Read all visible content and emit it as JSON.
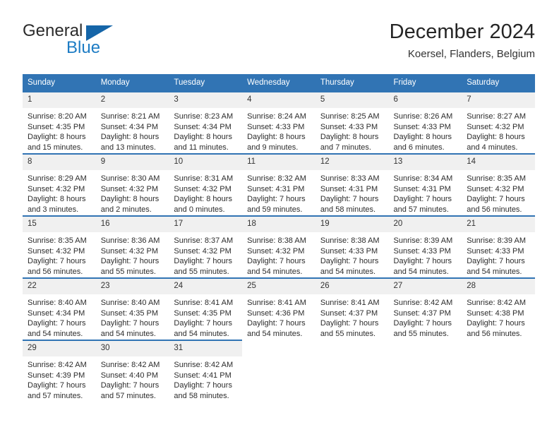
{
  "brand": {
    "name_part1": "General",
    "name_part2": "Blue",
    "triangle_color": "#1565a8",
    "blue_text_color": "#1d7cc4"
  },
  "header": {
    "title": "December 2024",
    "subtitle": "Koersel, Flanders, Belgium"
  },
  "theme": {
    "header_blue": "#3174b4",
    "daynum_band": "#f0f0f0",
    "text": "#2c2c2c"
  },
  "weekdays": [
    "Sunday",
    "Monday",
    "Tuesday",
    "Wednesday",
    "Thursday",
    "Friday",
    "Saturday"
  ],
  "days": [
    {
      "n": "1",
      "sunrise": "Sunrise: 8:20 AM",
      "sunset": "Sunset: 4:35 PM",
      "daylight1": "Daylight: 8 hours",
      "daylight2": "and 15 minutes."
    },
    {
      "n": "2",
      "sunrise": "Sunrise: 8:21 AM",
      "sunset": "Sunset: 4:34 PM",
      "daylight1": "Daylight: 8 hours",
      "daylight2": "and 13 minutes."
    },
    {
      "n": "3",
      "sunrise": "Sunrise: 8:23 AM",
      "sunset": "Sunset: 4:34 PM",
      "daylight1": "Daylight: 8 hours",
      "daylight2": "and 11 minutes."
    },
    {
      "n": "4",
      "sunrise": "Sunrise: 8:24 AM",
      "sunset": "Sunset: 4:33 PM",
      "daylight1": "Daylight: 8 hours",
      "daylight2": "and 9 minutes."
    },
    {
      "n": "5",
      "sunrise": "Sunrise: 8:25 AM",
      "sunset": "Sunset: 4:33 PM",
      "daylight1": "Daylight: 8 hours",
      "daylight2": "and 7 minutes."
    },
    {
      "n": "6",
      "sunrise": "Sunrise: 8:26 AM",
      "sunset": "Sunset: 4:33 PM",
      "daylight1": "Daylight: 8 hours",
      "daylight2": "and 6 minutes."
    },
    {
      "n": "7",
      "sunrise": "Sunrise: 8:27 AM",
      "sunset": "Sunset: 4:32 PM",
      "daylight1": "Daylight: 8 hours",
      "daylight2": "and 4 minutes."
    },
    {
      "n": "8",
      "sunrise": "Sunrise: 8:29 AM",
      "sunset": "Sunset: 4:32 PM",
      "daylight1": "Daylight: 8 hours",
      "daylight2": "and 3 minutes."
    },
    {
      "n": "9",
      "sunrise": "Sunrise: 8:30 AM",
      "sunset": "Sunset: 4:32 PM",
      "daylight1": "Daylight: 8 hours",
      "daylight2": "and 2 minutes."
    },
    {
      "n": "10",
      "sunrise": "Sunrise: 8:31 AM",
      "sunset": "Sunset: 4:32 PM",
      "daylight1": "Daylight: 8 hours",
      "daylight2": "and 0 minutes."
    },
    {
      "n": "11",
      "sunrise": "Sunrise: 8:32 AM",
      "sunset": "Sunset: 4:31 PM",
      "daylight1": "Daylight: 7 hours",
      "daylight2": "and 59 minutes."
    },
    {
      "n": "12",
      "sunrise": "Sunrise: 8:33 AM",
      "sunset": "Sunset: 4:31 PM",
      "daylight1": "Daylight: 7 hours",
      "daylight2": "and 58 minutes."
    },
    {
      "n": "13",
      "sunrise": "Sunrise: 8:34 AM",
      "sunset": "Sunset: 4:31 PM",
      "daylight1": "Daylight: 7 hours",
      "daylight2": "and 57 minutes."
    },
    {
      "n": "14",
      "sunrise": "Sunrise: 8:35 AM",
      "sunset": "Sunset: 4:32 PM",
      "daylight1": "Daylight: 7 hours",
      "daylight2": "and 56 minutes."
    },
    {
      "n": "15",
      "sunrise": "Sunrise: 8:35 AM",
      "sunset": "Sunset: 4:32 PM",
      "daylight1": "Daylight: 7 hours",
      "daylight2": "and 56 minutes."
    },
    {
      "n": "16",
      "sunrise": "Sunrise: 8:36 AM",
      "sunset": "Sunset: 4:32 PM",
      "daylight1": "Daylight: 7 hours",
      "daylight2": "and 55 minutes."
    },
    {
      "n": "17",
      "sunrise": "Sunrise: 8:37 AM",
      "sunset": "Sunset: 4:32 PM",
      "daylight1": "Daylight: 7 hours",
      "daylight2": "and 55 minutes."
    },
    {
      "n": "18",
      "sunrise": "Sunrise: 8:38 AM",
      "sunset": "Sunset: 4:32 PM",
      "daylight1": "Daylight: 7 hours",
      "daylight2": "and 54 minutes."
    },
    {
      "n": "19",
      "sunrise": "Sunrise: 8:38 AM",
      "sunset": "Sunset: 4:33 PM",
      "daylight1": "Daylight: 7 hours",
      "daylight2": "and 54 minutes."
    },
    {
      "n": "20",
      "sunrise": "Sunrise: 8:39 AM",
      "sunset": "Sunset: 4:33 PM",
      "daylight1": "Daylight: 7 hours",
      "daylight2": "and 54 minutes."
    },
    {
      "n": "21",
      "sunrise": "Sunrise: 8:39 AM",
      "sunset": "Sunset: 4:33 PM",
      "daylight1": "Daylight: 7 hours",
      "daylight2": "and 54 minutes."
    },
    {
      "n": "22",
      "sunrise": "Sunrise: 8:40 AM",
      "sunset": "Sunset: 4:34 PM",
      "daylight1": "Daylight: 7 hours",
      "daylight2": "and 54 minutes."
    },
    {
      "n": "23",
      "sunrise": "Sunrise: 8:40 AM",
      "sunset": "Sunset: 4:35 PM",
      "daylight1": "Daylight: 7 hours",
      "daylight2": "and 54 minutes."
    },
    {
      "n": "24",
      "sunrise": "Sunrise: 8:41 AM",
      "sunset": "Sunset: 4:35 PM",
      "daylight1": "Daylight: 7 hours",
      "daylight2": "and 54 minutes."
    },
    {
      "n": "25",
      "sunrise": "Sunrise: 8:41 AM",
      "sunset": "Sunset: 4:36 PM",
      "daylight1": "Daylight: 7 hours",
      "daylight2": "and 54 minutes."
    },
    {
      "n": "26",
      "sunrise": "Sunrise: 8:41 AM",
      "sunset": "Sunset: 4:37 PM",
      "daylight1": "Daylight: 7 hours",
      "daylight2": "and 55 minutes."
    },
    {
      "n": "27",
      "sunrise": "Sunrise: 8:42 AM",
      "sunset": "Sunset: 4:37 PM",
      "daylight1": "Daylight: 7 hours",
      "daylight2": "and 55 minutes."
    },
    {
      "n": "28",
      "sunrise": "Sunrise: 8:42 AM",
      "sunset": "Sunset: 4:38 PM",
      "daylight1": "Daylight: 7 hours",
      "daylight2": "and 56 minutes."
    },
    {
      "n": "29",
      "sunrise": "Sunrise: 8:42 AM",
      "sunset": "Sunset: 4:39 PM",
      "daylight1": "Daylight: 7 hours",
      "daylight2": "and 57 minutes."
    },
    {
      "n": "30",
      "sunrise": "Sunrise: 8:42 AM",
      "sunset": "Sunset: 4:40 PM",
      "daylight1": "Daylight: 7 hours",
      "daylight2": "and 57 minutes."
    },
    {
      "n": "31",
      "sunrise": "Sunrise: 8:42 AM",
      "sunset": "Sunset: 4:41 PM",
      "daylight1": "Daylight: 7 hours",
      "daylight2": "and 58 minutes."
    }
  ],
  "leading_blanks": 0,
  "weeks": 5
}
